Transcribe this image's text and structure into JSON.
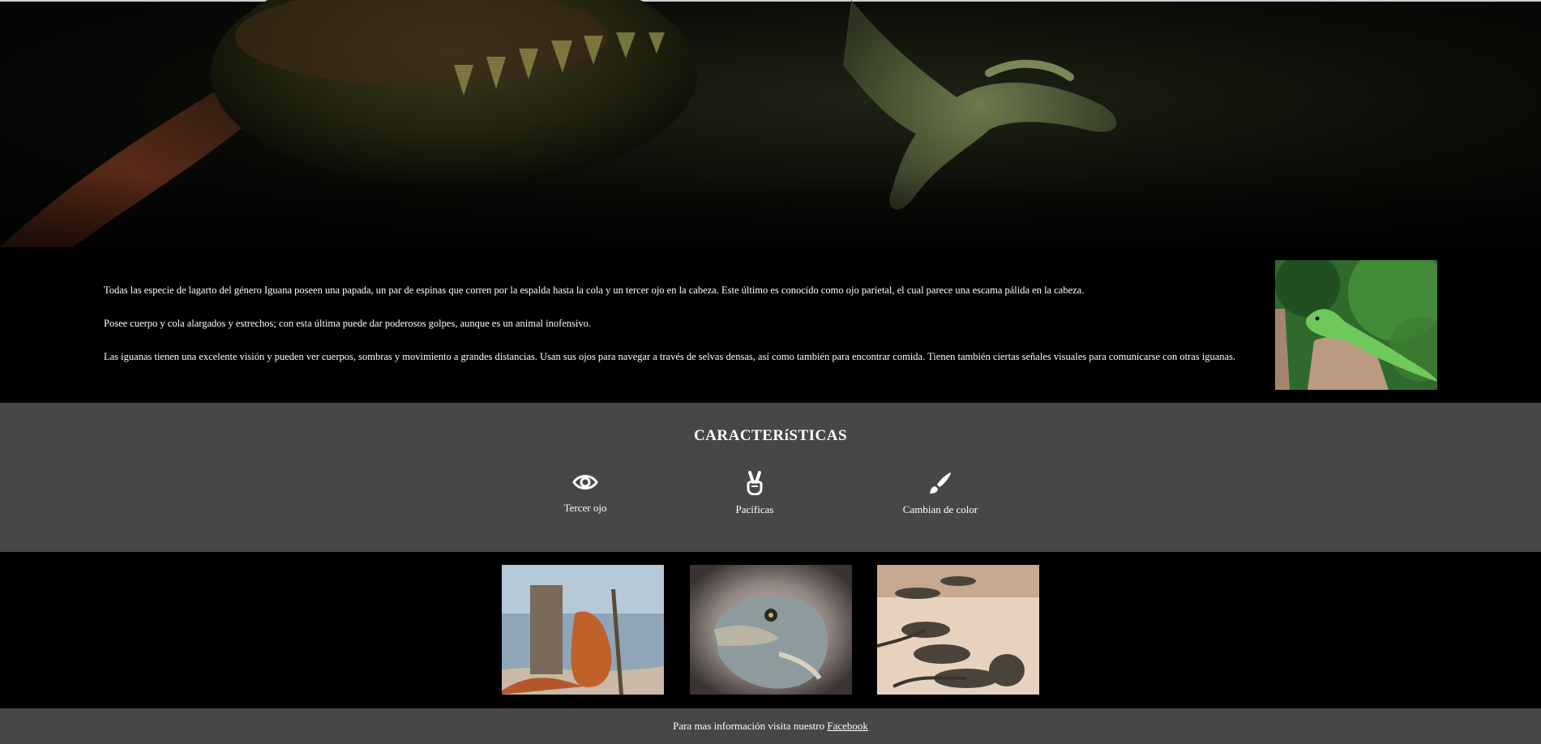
{
  "hero": {
    "image": "iguana-closeup-banner"
  },
  "intro": {
    "paragraphs": [
      "Todas las especie de lagarto del género Iguana poseen una papada, un par de espinas que corren por la espalda hasta la cola y un tercer ojo en la cabeza. Este último es conocido como ojo parietal, el cual parece una escama pálida en la cabeza.",
      "Posee cuerpo y cola alargados y estrechos; con esta última puede dar poderosos golpes, aunque es un animal inofensivo.",
      "Las iguanas tienen una excelente visión y pueden ver cuerpos, sombras y movimiento a grandes distancias. Usan sus ojos para navegar a través de selvas densas, así como también para encontrar comida. Tienen también ciertas señales visuales para comunicarse con otras iguanas."
    ],
    "image": "green-iguana-on-stump"
  },
  "features": {
    "title": "CARACTERíSTICAS",
    "items": [
      {
        "icon": "eye-icon",
        "label": "Tercer ojo"
      },
      {
        "icon": "peace-hand-icon",
        "label": "Pacíficas"
      },
      {
        "icon": "paint-brush-icon",
        "label": "Cambian de color"
      }
    ]
  },
  "gallery": {
    "images": [
      "iguana-on-beach",
      "iguana-head-portrait",
      "iguanas-on-sand"
    ]
  },
  "footer": {
    "text": "Para mas información visita nuestro ",
    "link_label": "Facebook"
  }
}
